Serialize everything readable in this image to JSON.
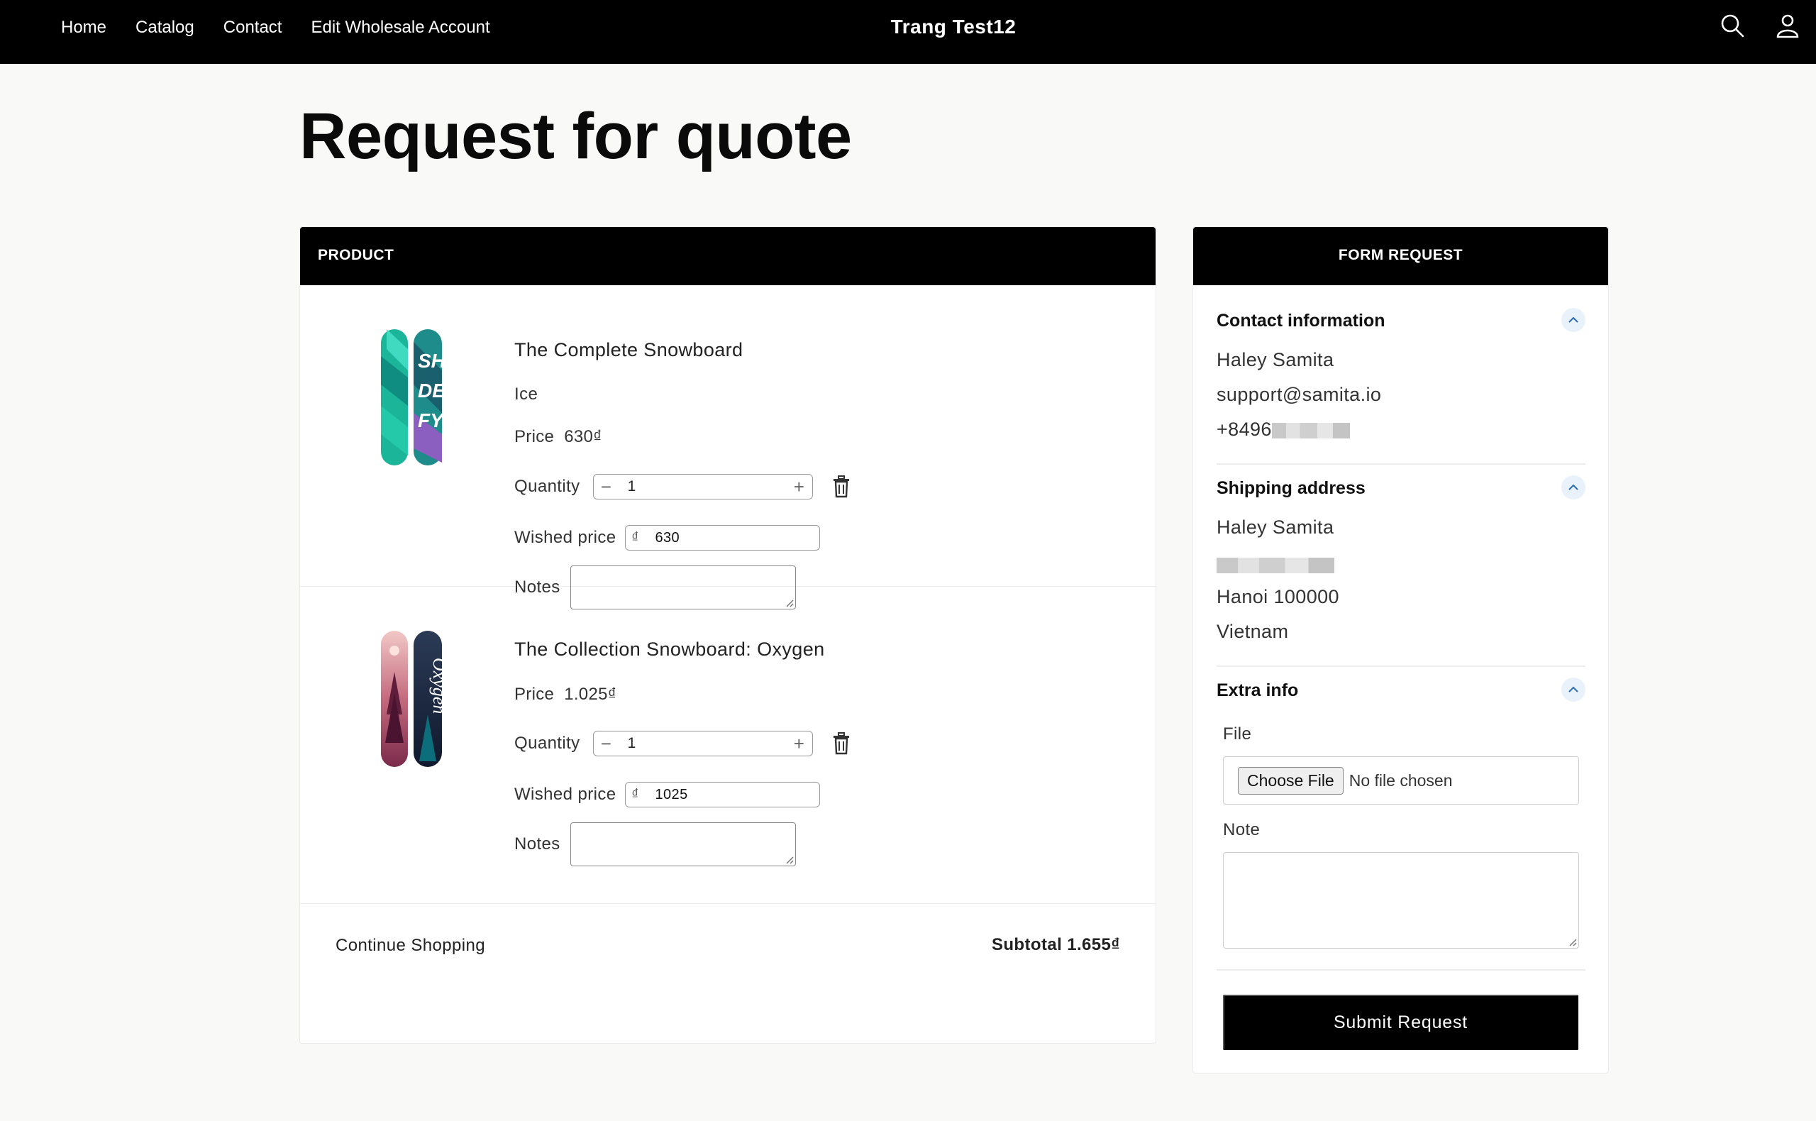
{
  "nav": {
    "items": [
      "Home",
      "Catalog",
      "Contact",
      "Edit Wholesale Account"
    ],
    "brand": "Trang Test12",
    "icons": [
      "search-icon",
      "account-icon"
    ]
  },
  "page": {
    "title": "Request for quote"
  },
  "product_table": {
    "header": "PRODUCT",
    "items": [
      {
        "name": "The Complete Snowboard",
        "variant": "Ice",
        "price_label": "Price",
        "price": "630₫",
        "quantity_label": "Quantity",
        "quantity": "1",
        "wished_label": "Wished price",
        "currency": "₫",
        "wished_price": "630",
        "notes_label": "Notes",
        "notes": ""
      },
      {
        "name": "The Collection Snowboard: Oxygen",
        "price_label": "Price",
        "price": "1.025₫",
        "quantity_label": "Quantity",
        "quantity": "1",
        "wished_label": "Wished price",
        "currency": "₫",
        "wished_price": "1025",
        "notes_label": "Notes",
        "notes": ""
      }
    ],
    "continue_label": "Continue Shopping",
    "subtotal": "Subtotal 1.655₫"
  },
  "form": {
    "header": "FORM REQUEST",
    "contact": {
      "title": "Contact information",
      "name": "Haley Samita",
      "email": "support@samita.io",
      "phone_visible": "+8496"
    },
    "shipping": {
      "title": "Shipping address",
      "name": "Haley Samita",
      "city": "Hanoi 100000",
      "country": "Vietnam"
    },
    "extra": {
      "title": "Extra info",
      "file_label": "File",
      "choose_file": "Choose File",
      "no_file": "No file chosen",
      "note_label": "Note",
      "note_value": ""
    },
    "submit": "Submit Request"
  },
  "colors": {
    "header_bg": "#000000",
    "page_bg": "#f9f9f8",
    "chevron_bg": "#e9f2fa",
    "accent": "#2a6db0"
  }
}
